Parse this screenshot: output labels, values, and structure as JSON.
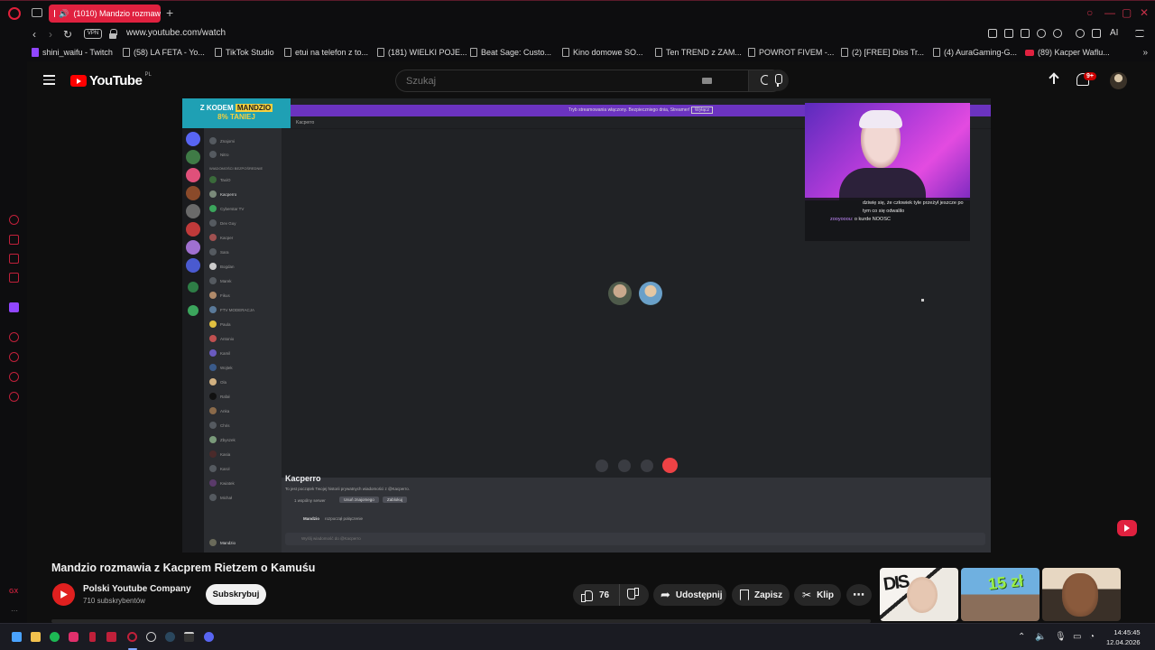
{
  "browser": {
    "tab_title": "(1010) Mandzio rozmaw",
    "new_tab": "+",
    "url": "www.youtube.com/watch",
    "vpn_label": "VPN",
    "ai_label": "AI",
    "accent": "#e0213f",
    "bookmarks": [
      "shini_waifu - Twitch",
      "(58) LA FETA - Yo...",
      "TikTok Studio",
      "etui na telefon z to...",
      "(181) WIELKI POJE...",
      "Beat Sage: Custo...",
      "Kino domowe SO...",
      "Ten TREND z ZAM...",
      "POWROT FIVEM -...",
      "(2) [FREE] Diss Tr...",
      "(4) AuraGaming-G...",
      "(89) Kacper Waflu..."
    ],
    "sidebar_badge": "GX"
  },
  "youtube": {
    "logo_text": "YouTube",
    "region": "PL",
    "search_placeholder": "Szukaj",
    "notification_count": "9+"
  },
  "video": {
    "promo_line1": "Z KODEM",
    "promo_code": "MANDZIO",
    "promo_line2": "8% TANIEJ",
    "discord_banner": "Tryb streamowania włączony. Bezpieczniego dnia, Streamer!",
    "discord_banner_btn": "Wyłącz",
    "discord_channel": "Kacperro",
    "discord_dm_title": "Kacperro",
    "discord_dm_line": "To jest początek Twojej historii prywatnych wiadomości z @Kacperro.",
    "discord_mutual": "1 wspólny serwer",
    "discord_remove_friend": "Usuń znajomego",
    "discord_block": "Zablokuj",
    "discord_message_author": "Mandzio",
    "discord_message_text": "rozpoczął połączenie",
    "discord_input_placeholder": "Wyślij wiadomość do @Kacperro",
    "discord_channels": [
      "Znajomi",
      "Nitro",
      "WIADOMOŚCI BEZPOŚREDNIE",
      "TaxiO",
      "Kacperro",
      "Cyberstar TV",
      "Dev Guy",
      "Kacper",
      "Sara",
      "Bogdan",
      "Marek",
      "Fikus",
      "FTV MODERACJA",
      "Paula",
      "Antonio",
      "Kamil",
      "Wojtek",
      "Ola",
      "Rafał",
      "Anka",
      "Chris",
      "Zbyszek",
      "Kasia",
      "Karol",
      "Kwiatek",
      "Michał"
    ],
    "discord_user": "Mandzio",
    "chat_message": "dziwię się, że człowiek tyle przeżył jeszcze po tym co się odwalilo",
    "chat_nick": "zooyooou:",
    "chat_message2": "o kurde NOOSC"
  },
  "watch": {
    "title": "Mandzio rozmawia z Kacprem Rietzem o Kamuśu",
    "channel_name": "Polski Youtube Company",
    "subscribers": "710 subskrybentów",
    "subscribe_label": "Subskrybuj",
    "like_count": "76",
    "share_label": "Udostępnij",
    "save_label": "Zapisz",
    "clip_label": "Klip",
    "more_label": "⋯",
    "thumb2_text": "15 zł",
    "progress_fraction": 0.0
  },
  "taskbar": {
    "time": "14:45:45",
    "date": "12.04.2026"
  }
}
